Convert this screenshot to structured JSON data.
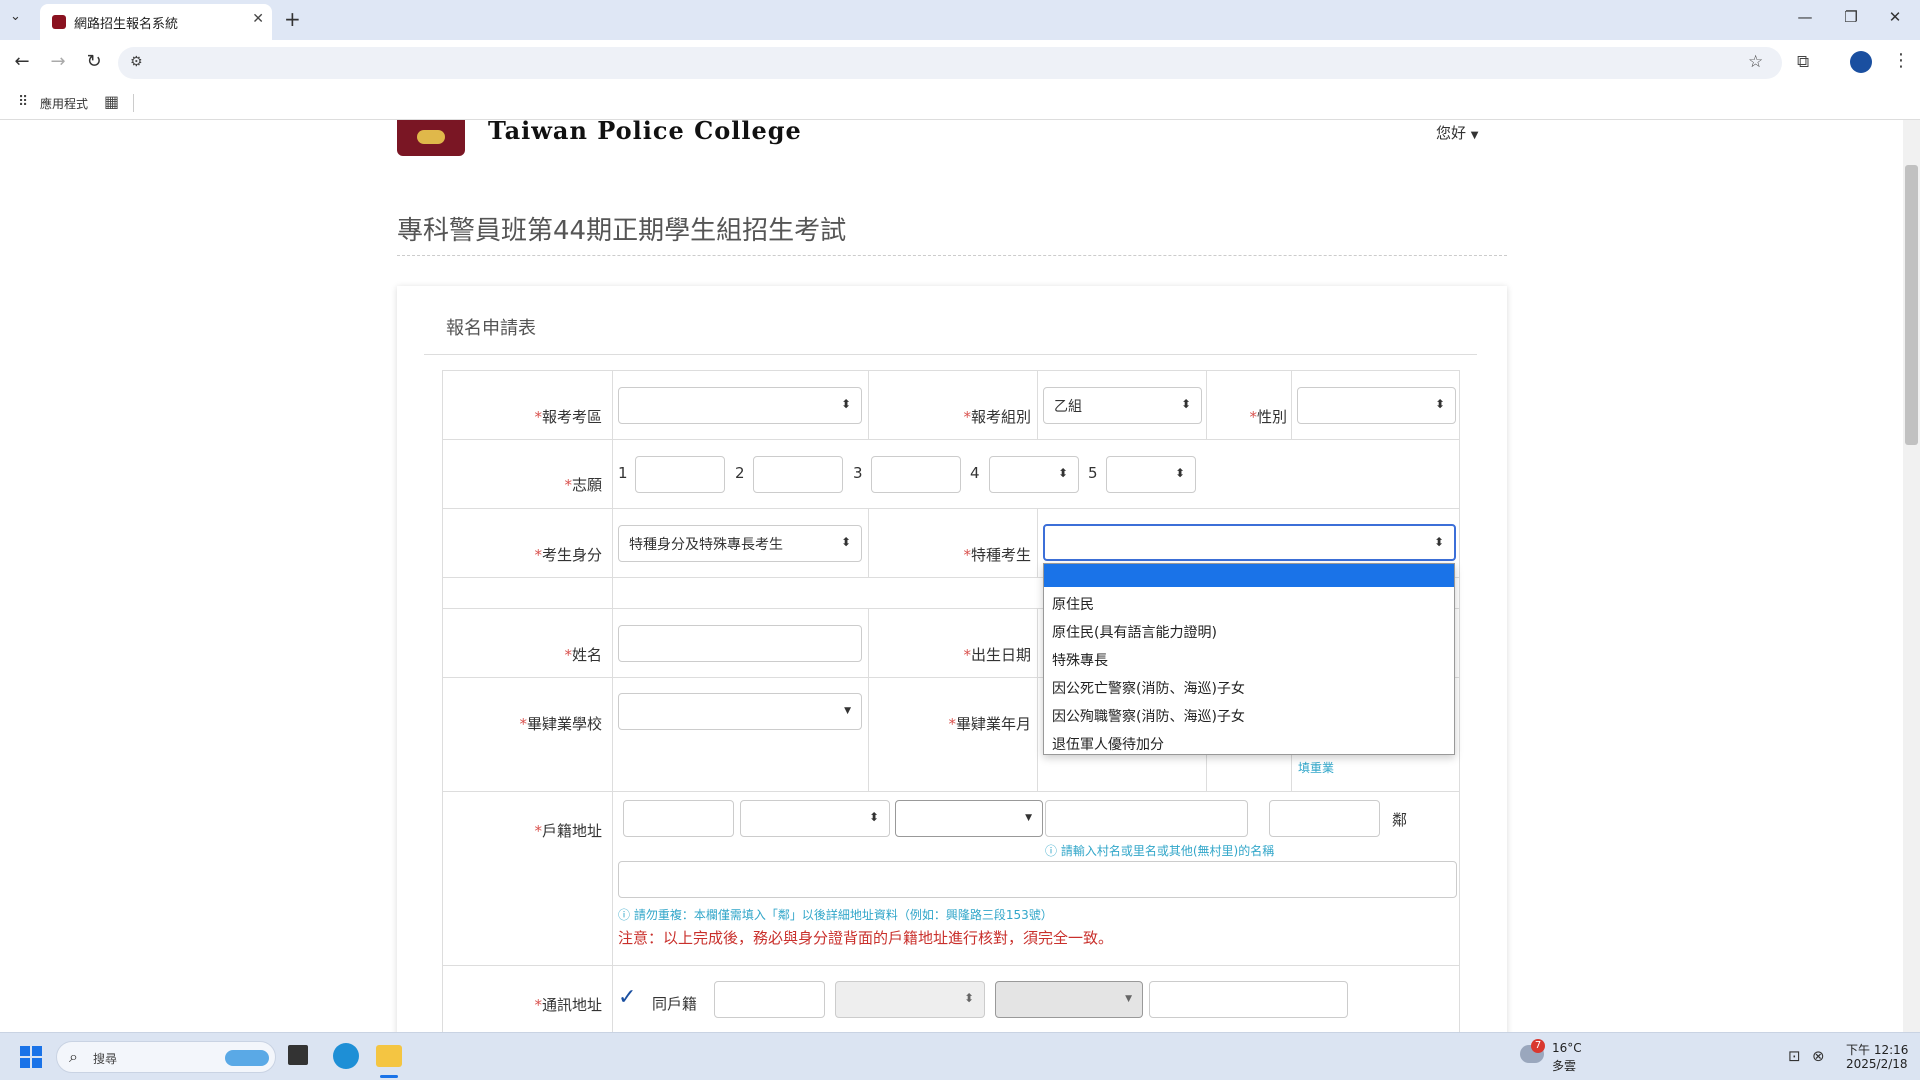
{
  "browser": {
    "tab_title": "網路招生報名系統",
    "tab_close": "✕",
    "new_tab": "+",
    "window": {
      "minimize": "—",
      "restore": "❐",
      "close": "✕"
    },
    "nav": {
      "back": "←",
      "forward": "→",
      "reload": "↻"
    },
    "bookmarks": {
      "apps_label": "應用程式"
    }
  },
  "header": {
    "brand": "Taiwan Police College",
    "user_menu": "您好"
  },
  "page": {
    "title": "專科警員班第44期正期學生組招生考試"
  },
  "form": {
    "title": "報名申請表",
    "star": "*",
    "labels": {
      "exam_area": "報考考區",
      "exam_group": "報考組別",
      "gender": "性別",
      "preference": "志願",
      "identity": "考生身分",
      "special": "特種考生",
      "name": "姓名",
      "birth": "出生日期",
      "school": "畢肄業學校",
      "grad_date": "畢肄業年月",
      "household_address": "戶籍地址",
      "mailing_address": "通訊地址"
    },
    "values": {
      "exam_group": "乙組",
      "identity": "特種身分及特殊專長考生"
    },
    "preference_numbers": [
      "1",
      "2",
      "3",
      "4",
      "5"
    ],
    "grad_link": "填重業",
    "neighborhood_suffix": "鄰",
    "hint_village": "請輸入村名或里名或其他(無村里)的名稱",
    "hint_address": "請勿重複：本欄僅需填入「鄰」以後詳細地址資料（例如：興隆路三段153號）",
    "warning": "注意：以上完成後，務必與身分證背面的戶籍地址進行核對，須完全一致。",
    "same_household": "同戶籍",
    "checkmark": "✓"
  },
  "special_dropdown": {
    "options": [
      "",
      "原住民",
      "原住民(具有語言能力證明)",
      "特殊專長",
      "因公死亡警察(消防、海巡)子女",
      "因公殉職警察(消防、海巡)子女",
      "退伍軍人優待加分"
    ],
    "highlight_color": "#1a73e8"
  },
  "taskbar": {
    "search_label": "搜尋",
    "weather_temp": "16°C",
    "weather_desc": "多雲",
    "weather_badge": "7",
    "time": "下午 12:16",
    "date": "2025/2/18"
  }
}
